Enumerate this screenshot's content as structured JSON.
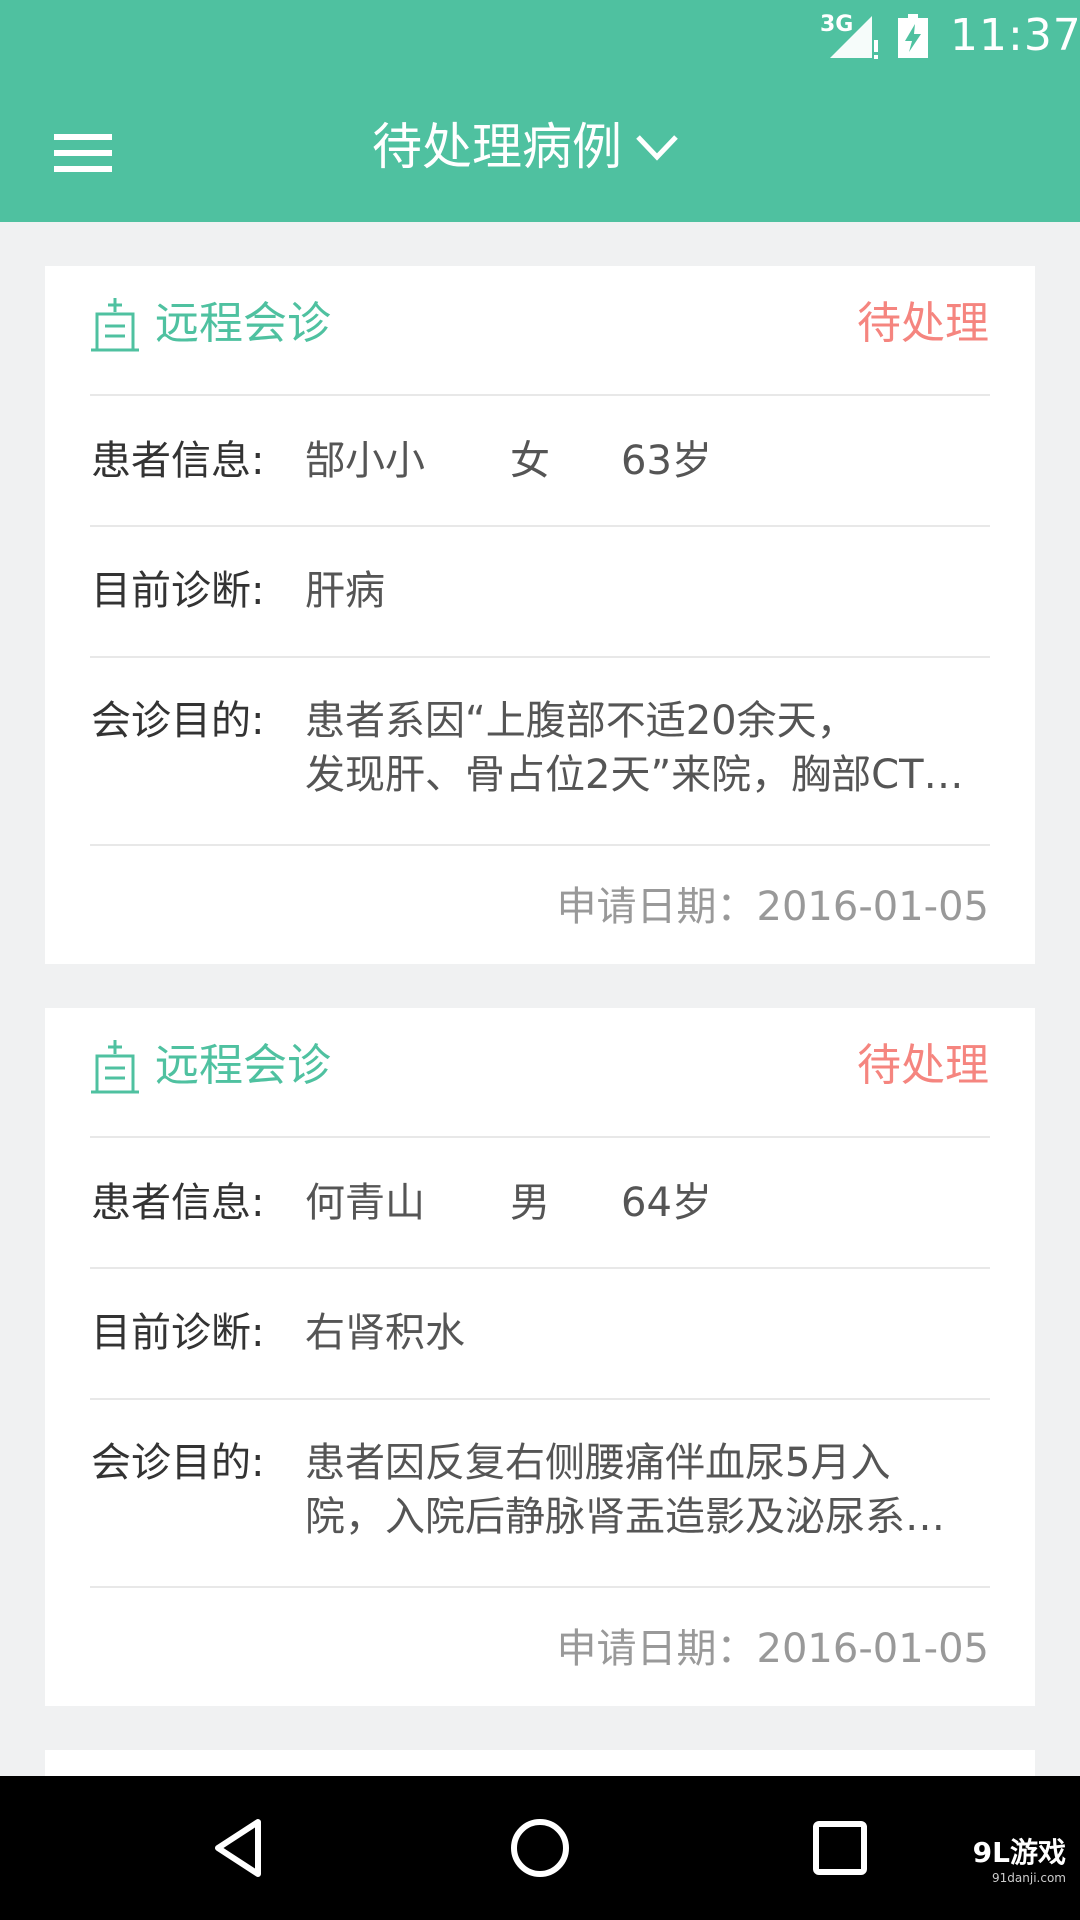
{
  "status_bar": {
    "network": "3G",
    "time": "11:37"
  },
  "app_bar": {
    "title": "待处理病例"
  },
  "labels": {
    "patient_info": "患者信息:",
    "diagnosis": "目前诊断:",
    "purpose": "会诊目的:"
  },
  "cards": [
    {
      "type": "远程会诊",
      "status": "待处理",
      "patient_name": "郜小小",
      "gender": "女",
      "age": "63岁",
      "diagnosis": "肝病",
      "purpose_line1": "患者系因“上腹部不适20余天，",
      "purpose_line2": "发现肝、骨占位2天”来院，胸部CT…",
      "apply_date": "申请日期：2016-01-05"
    },
    {
      "type": "远程会诊",
      "status": "待处理",
      "patient_name": "何青山",
      "gender": "男",
      "age": "64岁",
      "diagnosis": "右肾积水",
      "purpose_line1": "患者因反复右侧腰痛伴血尿5月入",
      "purpose_line2": "院，入院后静脉肾盂造影及泌尿系…",
      "apply_date": "申请日期：2016-01-05"
    }
  ],
  "watermark": {
    "main": "9L游戏",
    "sub": "91danji.com"
  },
  "colors": {
    "primary": "#4fc1a0",
    "status_pending": "#f5857f",
    "background": "#f0f1f2"
  }
}
